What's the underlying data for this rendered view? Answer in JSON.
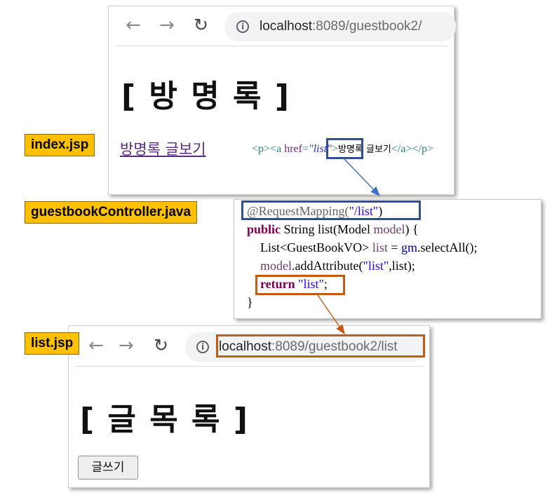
{
  "window_index": {
    "nav": {
      "back": "←",
      "forward": "→",
      "reload": "C"
    },
    "url_host": "localhost",
    "url_path": ":8089/guestbook2/",
    "heading": "[ 방 명 록 ]",
    "link_text": "방명록 글보기"
  },
  "labels": {
    "index": "index.jsp",
    "controller": "guestbookController.java",
    "list": "list.jsp"
  },
  "markup": {
    "open_tags": "<p><a ",
    "attr": "href",
    "eq": "=",
    "value": "\"list\"",
    "close_open": ">",
    "text": "방명록 글보기",
    "close_tags": "</a></p>"
  },
  "code": {
    "annotation_prefix": "@RequestMapping(",
    "annotation_value": "\"/list\"",
    "annotation_suffix": ")",
    "line2_kw": "public",
    "line2_rest1": " String list(Model ",
    "line2_var": "model",
    "line2_rest2": ") {",
    "line3_a": "List<GuestBookVO> ",
    "line3_var": "list",
    "line3_b": " = ",
    "line3_gm": "gm",
    "line3_c": ".selectAll();",
    "line4_var": "model",
    "line4_a": ".addAttribute(",
    "line4_str": "\"list\"",
    "line4_b": ",list);",
    "line5_kw": "return",
    "line5_str": " \"list\"",
    "line5_end": ";",
    "line6": "}"
  },
  "window_list": {
    "nav": {
      "back": "←",
      "forward": "→",
      "reload": "C"
    },
    "url_host": "localhost",
    "url_path": ":8089/guestbook2/list",
    "heading": "[ 글 목 록 ]",
    "button": "글쓰기"
  },
  "colors": {
    "label_bg": "#ffc000",
    "highlight_blue": "#2f4f8f",
    "highlight_orange": "#c55a11"
  }
}
